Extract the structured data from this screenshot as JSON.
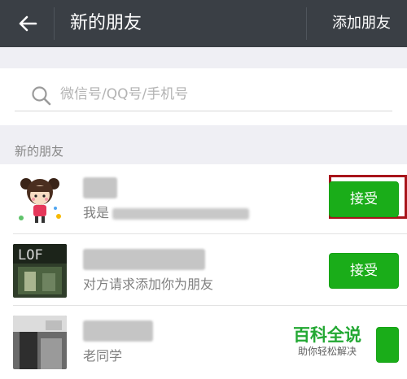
{
  "topbar": {
    "back_icon": "arrow-left-icon",
    "title": "新的朋友",
    "action_label": "添加朋友",
    "bg_color": "#3a3f45"
  },
  "search": {
    "icon": "search-icon",
    "placeholder": "微信号/QQ号/手机号"
  },
  "section": {
    "label": "新的朋友"
  },
  "requests": [
    {
      "name": "",
      "message_prefix": "我是",
      "action_label": "接受",
      "highlighted": true
    },
    {
      "name": "",
      "message": "对方请求添加你为朋友",
      "action_label": "接受",
      "highlighted": false
    },
    {
      "name": "",
      "message": "老同学",
      "action_label": "",
      "highlighted": false
    }
  ],
  "watermark": {
    "title": "百科全说",
    "subtitle": "助你轻松解决"
  },
  "colors": {
    "accent_green": "#1aad19",
    "highlight_red": "#a8141b",
    "background": "#efeff4"
  }
}
